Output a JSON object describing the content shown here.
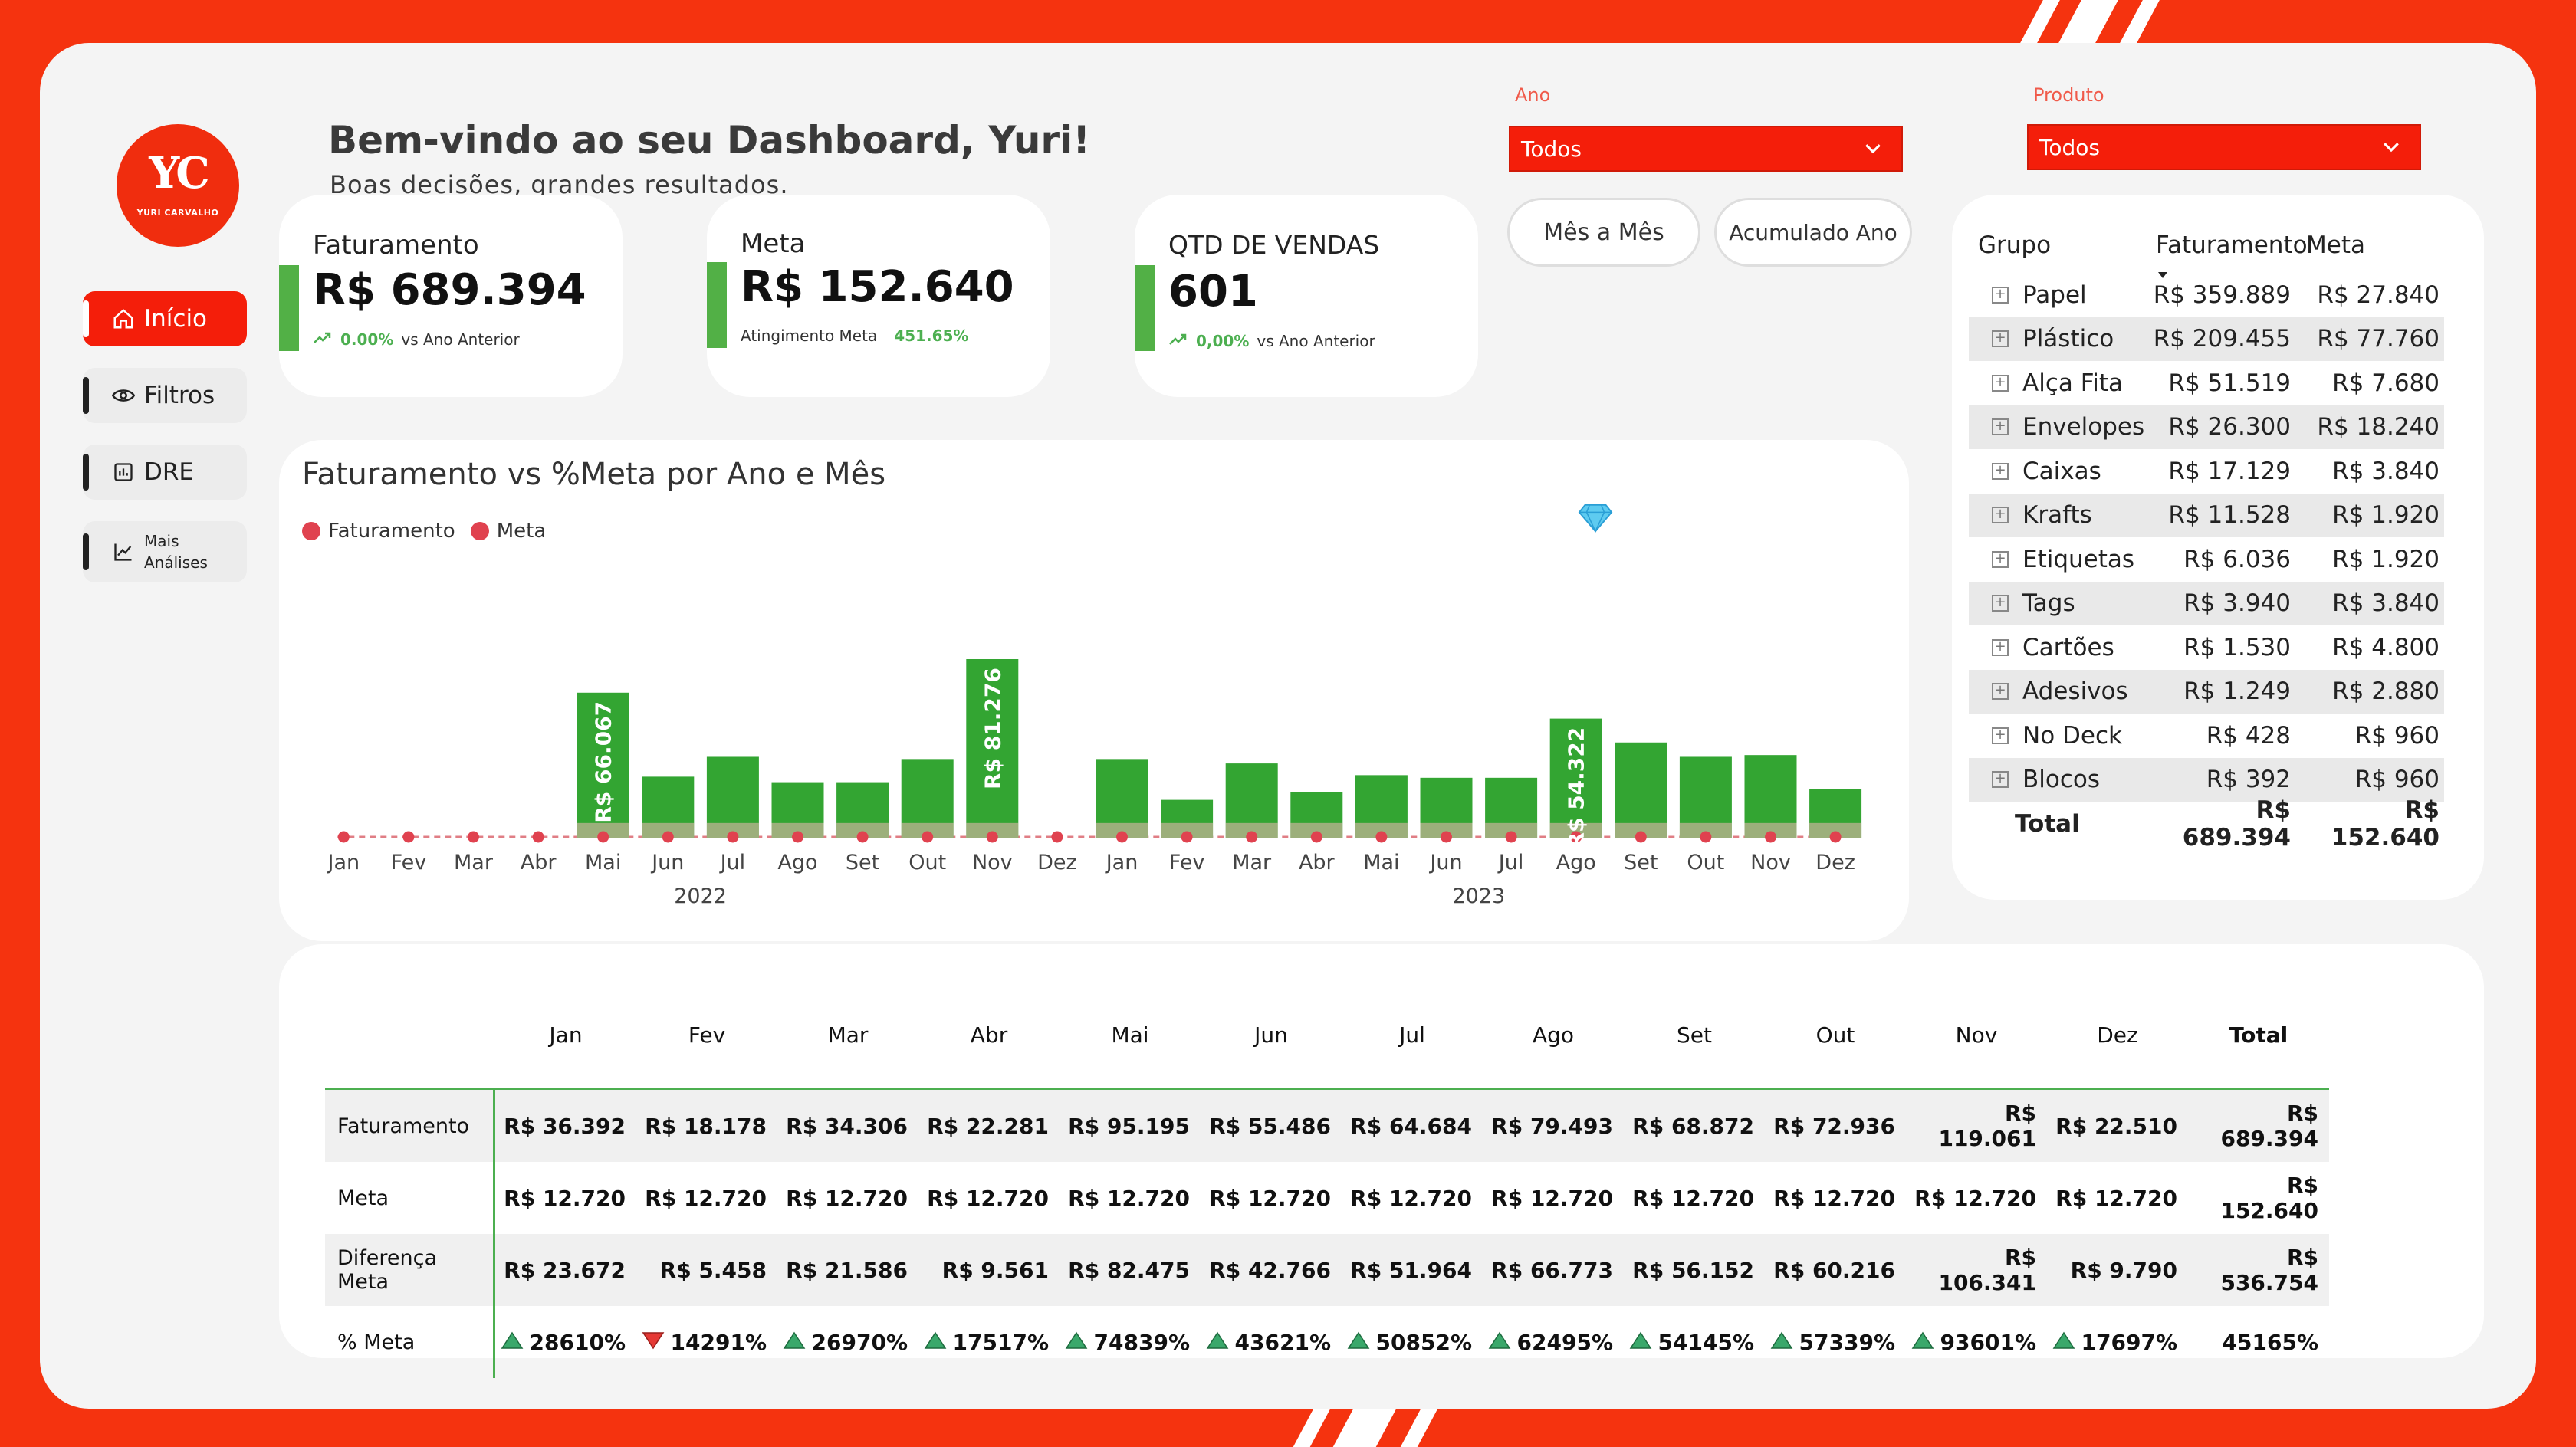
{
  "header": {
    "welcome": "Bem-vindo ao seu Dashboard, Yuri!",
    "tagline": "Boas decisões, grandes resultados."
  },
  "logo": {
    "monogram": "YC",
    "text": "YURI CARVALHO"
  },
  "nav": [
    {
      "label": "Início",
      "icon": "home-icon",
      "active": true
    },
    {
      "label": "Filtros",
      "icon": "eye-icon",
      "active": false
    },
    {
      "label": "DRE",
      "icon": "report-icon",
      "active": false
    },
    {
      "label": "Mais Análises",
      "icon": "line-chart-icon",
      "active": false
    }
  ],
  "filters": {
    "ano": {
      "label": "Ano",
      "value": "Todos"
    },
    "produto": {
      "label": "Produto",
      "value": "Todos"
    }
  },
  "toggles": {
    "mes": "Mês a Mês",
    "acumulado": "Acumulado Ano"
  },
  "kpis": {
    "faturamento": {
      "title": "Faturamento",
      "value": "R$ 689.394",
      "change": "0.00%",
      "change_label": "vs Ano Anterior"
    },
    "meta": {
      "title": "Meta",
      "value": "R$ 152.640",
      "sub_label": "Atingimento Meta",
      "sub_value": "451.65%"
    },
    "vendas": {
      "title": "QTD DE VENDAS",
      "value": "601",
      "change": "0,00%",
      "change_label": "vs Ano Anterior"
    }
  },
  "chart_data": {
    "type": "bar",
    "title": "Faturamento vs %Meta por Ano e Mês",
    "legend": [
      "Faturamento",
      "Meta"
    ],
    "categories": [
      "Jan",
      "Fev",
      "Mar",
      "Abr",
      "Mai",
      "Jun",
      "Jul",
      "Ago",
      "Set",
      "Out",
      "Nov",
      "Dez",
      "Jan",
      "Fev",
      "Mar",
      "Abr",
      "Mai",
      "Jun",
      "Jul",
      "Ago",
      "Set",
      "Out",
      "Nov",
      "Dez"
    ],
    "year_labels": [
      {
        "label": "2022",
        "span": [
          0,
          11
        ]
      },
      {
        "label": "2023",
        "span": [
          12,
          23
        ]
      }
    ],
    "series": [
      {
        "name": "Faturamento",
        "values": [
          0,
          0,
          0,
          0,
          66067,
          28000,
          37000,
          25500,
          25500,
          36000,
          81276,
          0,
          36000,
          17500,
          34000,
          21000,
          28700,
          27500,
          27500,
          54322,
          43500,
          37000,
          37800,
          22500
        ]
      },
      {
        "name": "Meta",
        "values": [
          0,
          0,
          0,
          0,
          7000,
          7000,
          7000,
          7000,
          7000,
          7000,
          7000,
          0,
          7000,
          7000,
          7000,
          7000,
          7000,
          7000,
          7000,
          7000,
          7000,
          7000,
          7000,
          7000
        ]
      }
    ],
    "data_labels": [
      {
        "index": 4,
        "text": "R$ 66.067"
      },
      {
        "index": 10,
        "text": "R$ 81.276"
      },
      {
        "index": 19,
        "text": "R$ 54.322"
      }
    ],
    "colors": {
      "bar": "#33a532",
      "meta_band": "#f2b8b8",
      "meta_dot": "#e0424f"
    }
  },
  "group_table": {
    "headers": [
      "Grupo",
      "Faturamento",
      "Meta"
    ],
    "rows": [
      [
        "Papel",
        "R$ 359.889",
        "R$ 27.840"
      ],
      [
        "Plástico",
        "R$ 209.455",
        "R$ 77.760"
      ],
      [
        "Alça Fita",
        "R$ 51.519",
        "R$ 7.680"
      ],
      [
        "Envelopes",
        "R$ 26.300",
        "R$ 18.240"
      ],
      [
        "Caixas",
        "R$ 17.129",
        "R$ 3.840"
      ],
      [
        "Krafts",
        "R$ 11.528",
        "R$ 1.920"
      ],
      [
        "Etiquetas",
        "R$ 6.036",
        "R$ 1.920"
      ],
      [
        "Tags",
        "R$ 3.940",
        "R$ 3.840"
      ],
      [
        "Cartões",
        "R$ 1.530",
        "R$ 4.800"
      ],
      [
        "Adesivos",
        "R$ 1.249",
        "R$ 2.880"
      ],
      [
        "No Deck",
        "R$ 428",
        "R$ 960"
      ],
      [
        "Blocos",
        "R$ 392",
        "R$ 960"
      ]
    ],
    "total": [
      "Total",
      "R$ 689.394",
      "R$ 152.640"
    ]
  },
  "monthly_table": {
    "columns": [
      "Jan",
      "Fev",
      "Mar",
      "Abr",
      "Mai",
      "Jun",
      "Jul",
      "Ago",
      "Set",
      "Out",
      "Nov",
      "Dez",
      "Total"
    ],
    "rows": [
      {
        "label": "Faturamento",
        "values": [
          "R$ 36.392",
          "R$ 18.178",
          "R$ 34.306",
          "R$ 22.281",
          "R$ 95.195",
          "R$ 55.486",
          "R$ 64.684",
          "R$ 79.493",
          "R$ 68.872",
          "R$ 72.936",
          "R$ 119.061",
          "R$ 22.510",
          "R$ 689.394"
        ]
      },
      {
        "label": "Meta",
        "values": [
          "R$ 12.720",
          "R$ 12.720",
          "R$ 12.720",
          "R$ 12.720",
          "R$ 12.720",
          "R$ 12.720",
          "R$ 12.720",
          "R$ 12.720",
          "R$ 12.720",
          "R$ 12.720",
          "R$ 12.720",
          "R$ 12.720",
          "R$ 152.640"
        ]
      },
      {
        "label": "Diferença Meta",
        "values": [
          "R$ 23.672",
          "R$ 5.458",
          "R$ 21.586",
          "R$ 9.561",
          "R$ 82.475",
          "R$ 42.766",
          "R$ 51.964",
          "R$ 66.773",
          "R$ 56.152",
          "R$ 60.216",
          "R$ 106.341",
          "R$ 9.790",
          "R$ 536.754"
        ]
      },
      {
        "label": "% Meta",
        "values": [
          "28610%",
          "14291%",
          "26970%",
          "17517%",
          "74839%",
          "43621%",
          "50852%",
          "62495%",
          "54145%",
          "57339%",
          "93601%",
          "17697%",
          "45165%"
        ],
        "trend": [
          "up",
          "down",
          "up",
          "up",
          "up",
          "up",
          "up",
          "up",
          "up",
          "up",
          "up",
          "up",
          ""
        ]
      }
    ]
  }
}
